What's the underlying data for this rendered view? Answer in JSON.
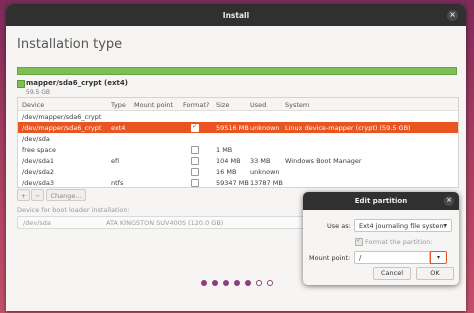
{
  "window": {
    "title": "Install"
  },
  "page": {
    "title": "Installation type"
  },
  "disk_bar": {
    "legend_name": "mapper/sda6_crypt (ext4)",
    "legend_size": "59.5 GB"
  },
  "table": {
    "headers": [
      "Device",
      "Type",
      "Mount point",
      "Format?",
      "Size",
      "Used",
      "System"
    ],
    "rows": [
      {
        "device": "/dev/mapper/sda6_crypt",
        "type": "",
        "mount": "",
        "format": null,
        "size": "",
        "used": "",
        "system": ""
      },
      {
        "device": "/dev/mapper/sda6_crypt",
        "type": "ext4",
        "mount": "",
        "format": true,
        "size": "59516 MB",
        "used": "unknown",
        "system": "Linux device-mapper (crypt) (59.5 GB)",
        "selected": true
      },
      {
        "device": "/dev/sda",
        "type": "",
        "mount": "",
        "format": null,
        "size": "",
        "used": "",
        "system": ""
      },
      {
        "device": "free space",
        "type": "",
        "mount": "",
        "format": false,
        "size": "1 MB",
        "used": "",
        "system": ""
      },
      {
        "device": "/dev/sda1",
        "type": "efi",
        "mount": "",
        "format": false,
        "size": "104 MB",
        "used": "33 MB",
        "system": "Windows Boot Manager"
      },
      {
        "device": "/dev/sda2",
        "type": "",
        "mount": "",
        "format": false,
        "size": "16 MB",
        "used": "unknown",
        "system": ""
      },
      {
        "device": "/dev/sda3",
        "type": "ntfs",
        "mount": "",
        "format": false,
        "size": "59347 MB",
        "used": "13787 MB",
        "system": ""
      }
    ]
  },
  "toolbar": {
    "add": "+",
    "remove": "−",
    "change": "Change..."
  },
  "bootloader": {
    "label": "Device for boot loader installation:",
    "device": "/dev/sda",
    "model": "ATA KINGSTON SUV400S (120.0 GB)"
  },
  "progress": {
    "total": 7,
    "filled": 5
  },
  "dialog": {
    "title": "Edit partition",
    "use_as_label": "Use as:",
    "use_as_value": "Ext4 journaling file system",
    "format_label": "Format the partition:",
    "format_checked": true,
    "mount_label": "Mount point:",
    "mount_value": "/",
    "cancel": "Cancel",
    "ok": "OK"
  }
}
